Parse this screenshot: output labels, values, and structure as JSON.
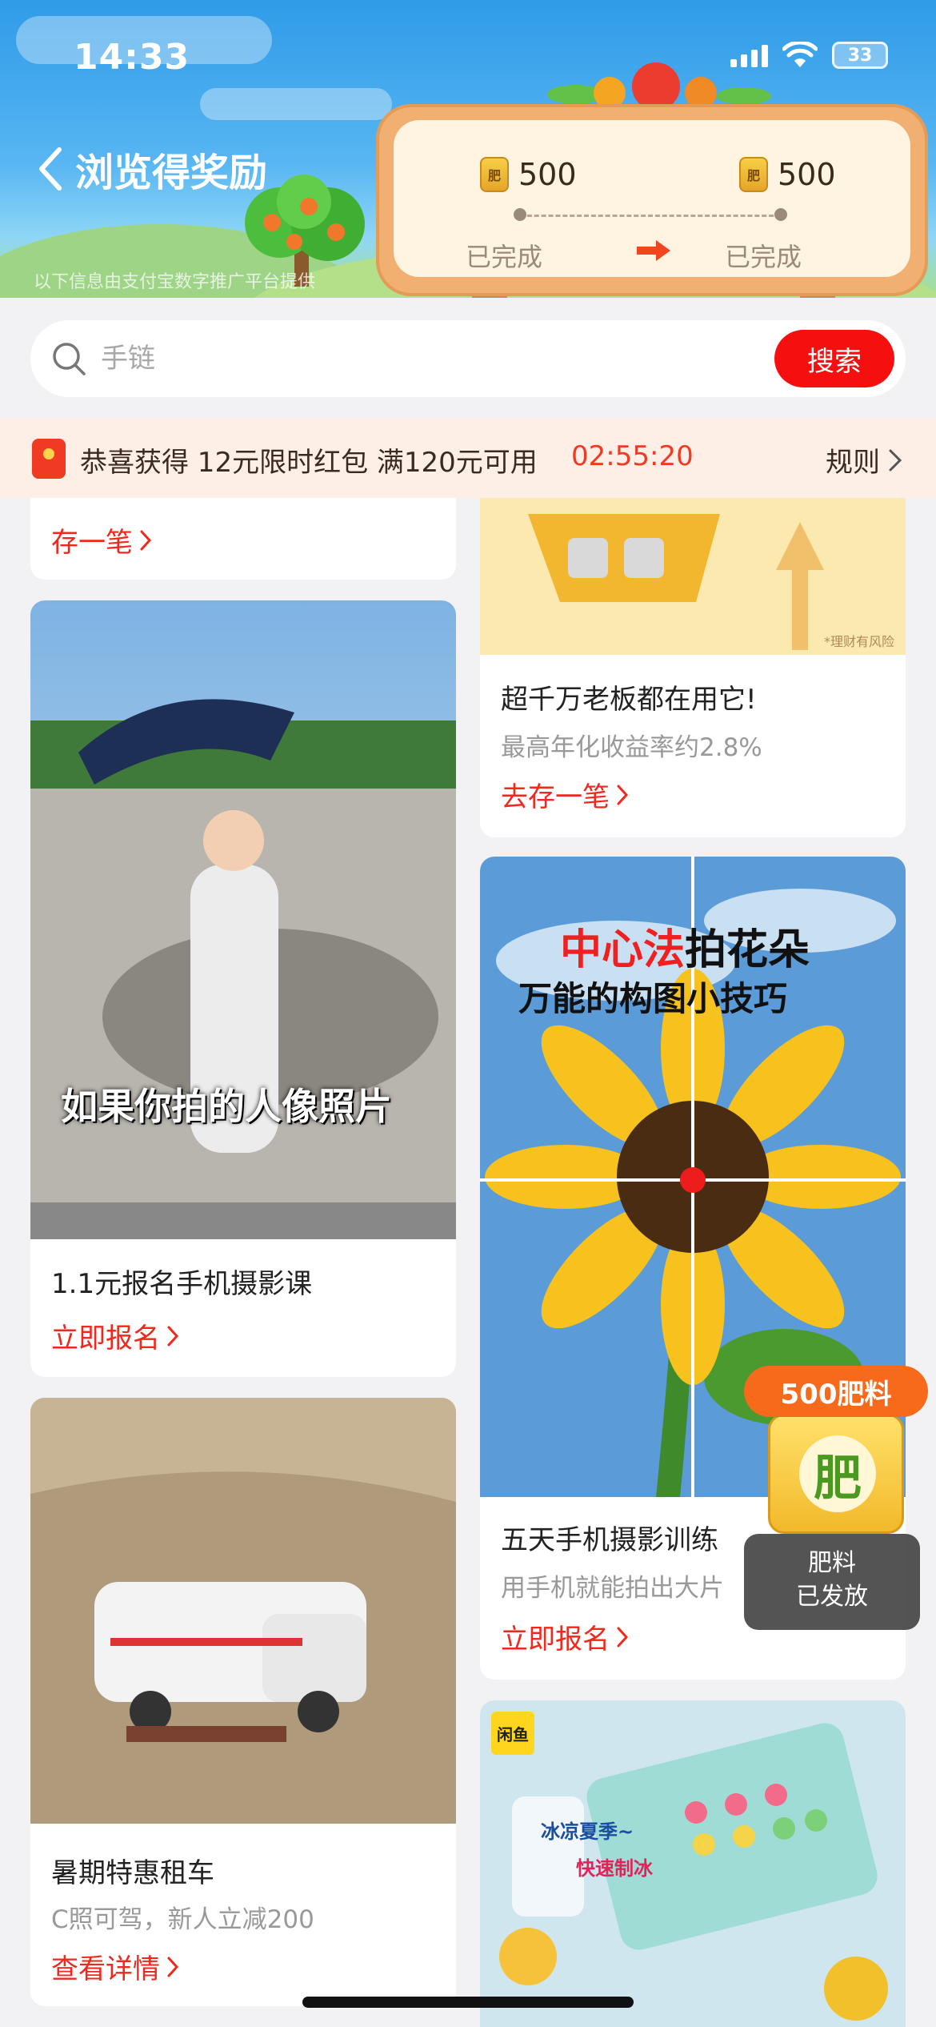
{
  "status_bar": {
    "time": "14:33",
    "battery": "33"
  },
  "header": {
    "back_label": "浏览得奖励",
    "disclaimer": "以下信息由支付宝数字推广平台提供",
    "rewards": [
      {
        "coin_label": "肥",
        "amount": "500",
        "status": "已完成"
      },
      {
        "coin_label": "肥",
        "amount": "500",
        "status": "已完成"
      }
    ]
  },
  "search": {
    "placeholder": "手链",
    "button_label": "搜索"
  },
  "banner": {
    "text": "恭喜获得 12元限时红包 满120元可用",
    "timer": "02:55:20",
    "rule_label": "规则"
  },
  "feed": {
    "left": [
      {
        "cta": "存一笔"
      },
      {
        "overlay": "如果你拍的人像照片",
        "title": "1.1元报名手机摄影课",
        "cta": "立即报名"
      },
      {
        "title": "暑期特惠租车",
        "subtitle": "C照可驾，新人立减200",
        "cta": "查看详情"
      }
    ],
    "right": [
      {
        "risk_note": "*理财有风险",
        "title": "超千万老板都在用它!",
        "subtitle": "最高年化收益率约2.8%",
        "cta": "去存一笔"
      },
      {
        "overlay_line1_red": "中心法",
        "overlay_line1_black": "拍花朵",
        "overlay_line2": "万能的构图小技巧",
        "title": "五天手机摄影训练",
        "subtitle": "用手机就能拍出大片",
        "cta": "立即报名"
      },
      {
        "brand_tag": "闲鱼",
        "bubble_line1": "冰凉夏季~",
        "bubble_line2": "快速制冰"
      }
    ]
  },
  "fertilizer_widget": {
    "pill": "500肥料",
    "jar_char": "肥",
    "status_line1": "肥料",
    "status_line2": "已发放"
  },
  "colors": {
    "accent_red": "#f60f0f",
    "orange": "#f76a1c"
  }
}
